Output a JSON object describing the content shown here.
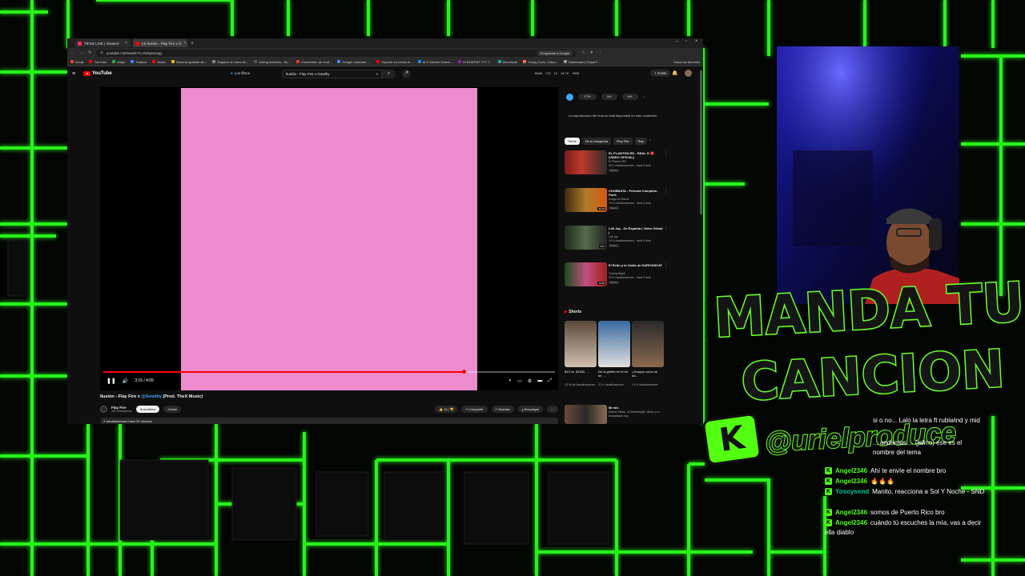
{
  "browser": {
    "tabs": [
      {
        "label": "TikTok LIVE | Viewer2",
        "color": "#ff2f55"
      },
      {
        "label": "(4) Ilusión - Flay Fire x G",
        "color": "#ff0000"
      }
    ],
    "url": "youtube.com/watch?v=NZqnvxcqg",
    "update_label": "Pregúntale a Google",
    "bookmarks": [
      {
        "label": "Gmail",
        "color": "#ea4335"
      },
      {
        "label": "YouTube",
        "color": "#ff0000"
      },
      {
        "label": "Maps",
        "color": "#34a853"
      },
      {
        "label": "Traducir",
        "color": "#4285f4"
      },
      {
        "label": "Music",
        "color": "#ff0000"
      },
      {
        "label": "Recurso gratuito de...",
        "color": "#f4b400"
      },
      {
        "label": "Registro en línea de...",
        "color": "#888888"
      },
      {
        "label": "mixing archives - Re...",
        "color": "#555555"
      },
      {
        "label": "Convertidor de Yout...",
        "color": "#e53935"
      },
      {
        "label": "Google Calendar -...",
        "color": "#4285f4"
      },
      {
        "label": "Soporte en forma di...",
        "color": "#ff0000"
      },
      {
        "label": "M.S Stream Online...",
        "color": "#1e88e5"
      },
      {
        "label": "Hi BONTMT 7+F 7...",
        "color": "#8e24aa"
      },
      {
        "label": "Discobook",
        "color": "#26a69a"
      },
      {
        "label": "Young Conn, Julian...",
        "color": "#ff7043"
      },
      {
        "label": "Dashboard | Royal F...",
        "color": "#999999"
      }
    ],
    "all_bookmarks": "Todos los favoritos"
  },
  "youtube": {
    "logo": "YouTube",
    "filter": "Los filtros",
    "search_value": "Ilusión - Flay Fire x Gowthy",
    "stats": [
      "8686",
      "176",
      "10",
      "18.7K",
      "4900"
    ],
    "create_label": "Crear",
    "player": {
      "time": "3:15 / 4:05",
      "progress": 0.8
    },
    "video_title_prefix": "Ilusión - Flay Fire x ",
    "video_title_handle": "@Gowthy",
    "video_title_suffix": " (Prod. TheX Music)",
    "channel_name": "Flay Fire",
    "channel_subs": "181 suscriptores",
    "subscribe_label": "Suscribirse",
    "join_label": "Unirse",
    "like_count": "11",
    "share_label": "Compartir",
    "save_label": "Guardar",
    "download_label": "Descargar",
    "description": "4 visualizaciones  hace 32 minutos",
    "chat_options": [
      "275%",
      "N/A",
      "N/A"
    ],
    "chat_note": "La reproducción del chat no está disponible en este contenido.",
    "chips": [
      "Todos",
      "De tu búsqueda",
      "Flay Fire",
      "Rap"
    ],
    "recommendations": [
      {
        "title": "EL PLANTON RD - REAL G 🔴 (VIDEO OFICIAL)",
        "channel": "El Planton RD",
        "meta": "58 K visualizaciones · hace 5 días",
        "badge": "Nuevo"
      },
      {
        "title": "CHUBBATA - Película Completa - Part1",
        "channel": "Dodgo en Barrio",
        "meta": "76 K visualizaciones · hace 5 días",
        "badge": "Nuevo",
        "duration": "42:10"
      },
      {
        "title": "Lüli Jay - De Espalda | Video Oficial |",
        "channel": "Lüli Jay",
        "meta": "13 K visualizaciones · hace 5 días",
        "badge": "Nuevo",
        "duration": "3:04"
      },
      {
        "title": "El Éxito y la Caída de DARIYANCAT",
        "channel": "Tommy Black",
        "meta": "34 K visualizaciones · hace 3 días",
        "badge": "Nuevo",
        "duration": "15:08"
      }
    ],
    "shorts_heading": "Shorts",
    "shorts": [
      {
        "title": "$13 vs. $1300 ...",
        "views": "4,5 M de visualizaciones"
      },
      {
        "title": "De la ghetto en el tío de ...",
        "views": "22 K visualizaciones"
      },
      {
        "title": "¿Huayco como se da...",
        "views": "1,9 K visualizaciones"
      }
    ],
    "mix": {
      "title": "Mi mix",
      "sub": "Marcel Villain, JJ MontenegR, Varios y m...",
      "meta": "Actualizado hoy"
    }
  },
  "banner": {
    "line1": "MANDA TU",
    "line2": "CANCION",
    "handle": "@urielproduce",
    "logo": "K"
  },
  "chat": [
    {
      "user": "",
      "text": "si o no... Lalo la letra ft rubiwind y mid",
      "color": "#ffffff"
    },
    {
      "user": "",
      "text": "... andamos ... (jalino) ese es el nombre del tema",
      "color": "#ffffff"
    },
    {
      "user": "Angel2346",
      "text": "Ahí te envíe el nombre bro",
      "color": "#53fc18"
    },
    {
      "user": "Angel2346",
      "text": "🔥🔥🔥",
      "color": "#53fc18"
    },
    {
      "user": "Yosoysend",
      "text": "Manito, reacciona a Sol Y Noche - SND",
      "color": "#00c49a"
    },
    {
      "user": "Angel2346",
      "text": "somos de Puerto Rico bro",
      "color": "#53fc18"
    },
    {
      "user": "Angel2346",
      "text": "cuándo tú escuches la mía, vas a decir ella diablo",
      "color": "#53fc18"
    }
  ],
  "colors": {
    "accent": "#53fc18",
    "thumbnail": "#ec8ccf",
    "yt_red": "#ff0000"
  }
}
